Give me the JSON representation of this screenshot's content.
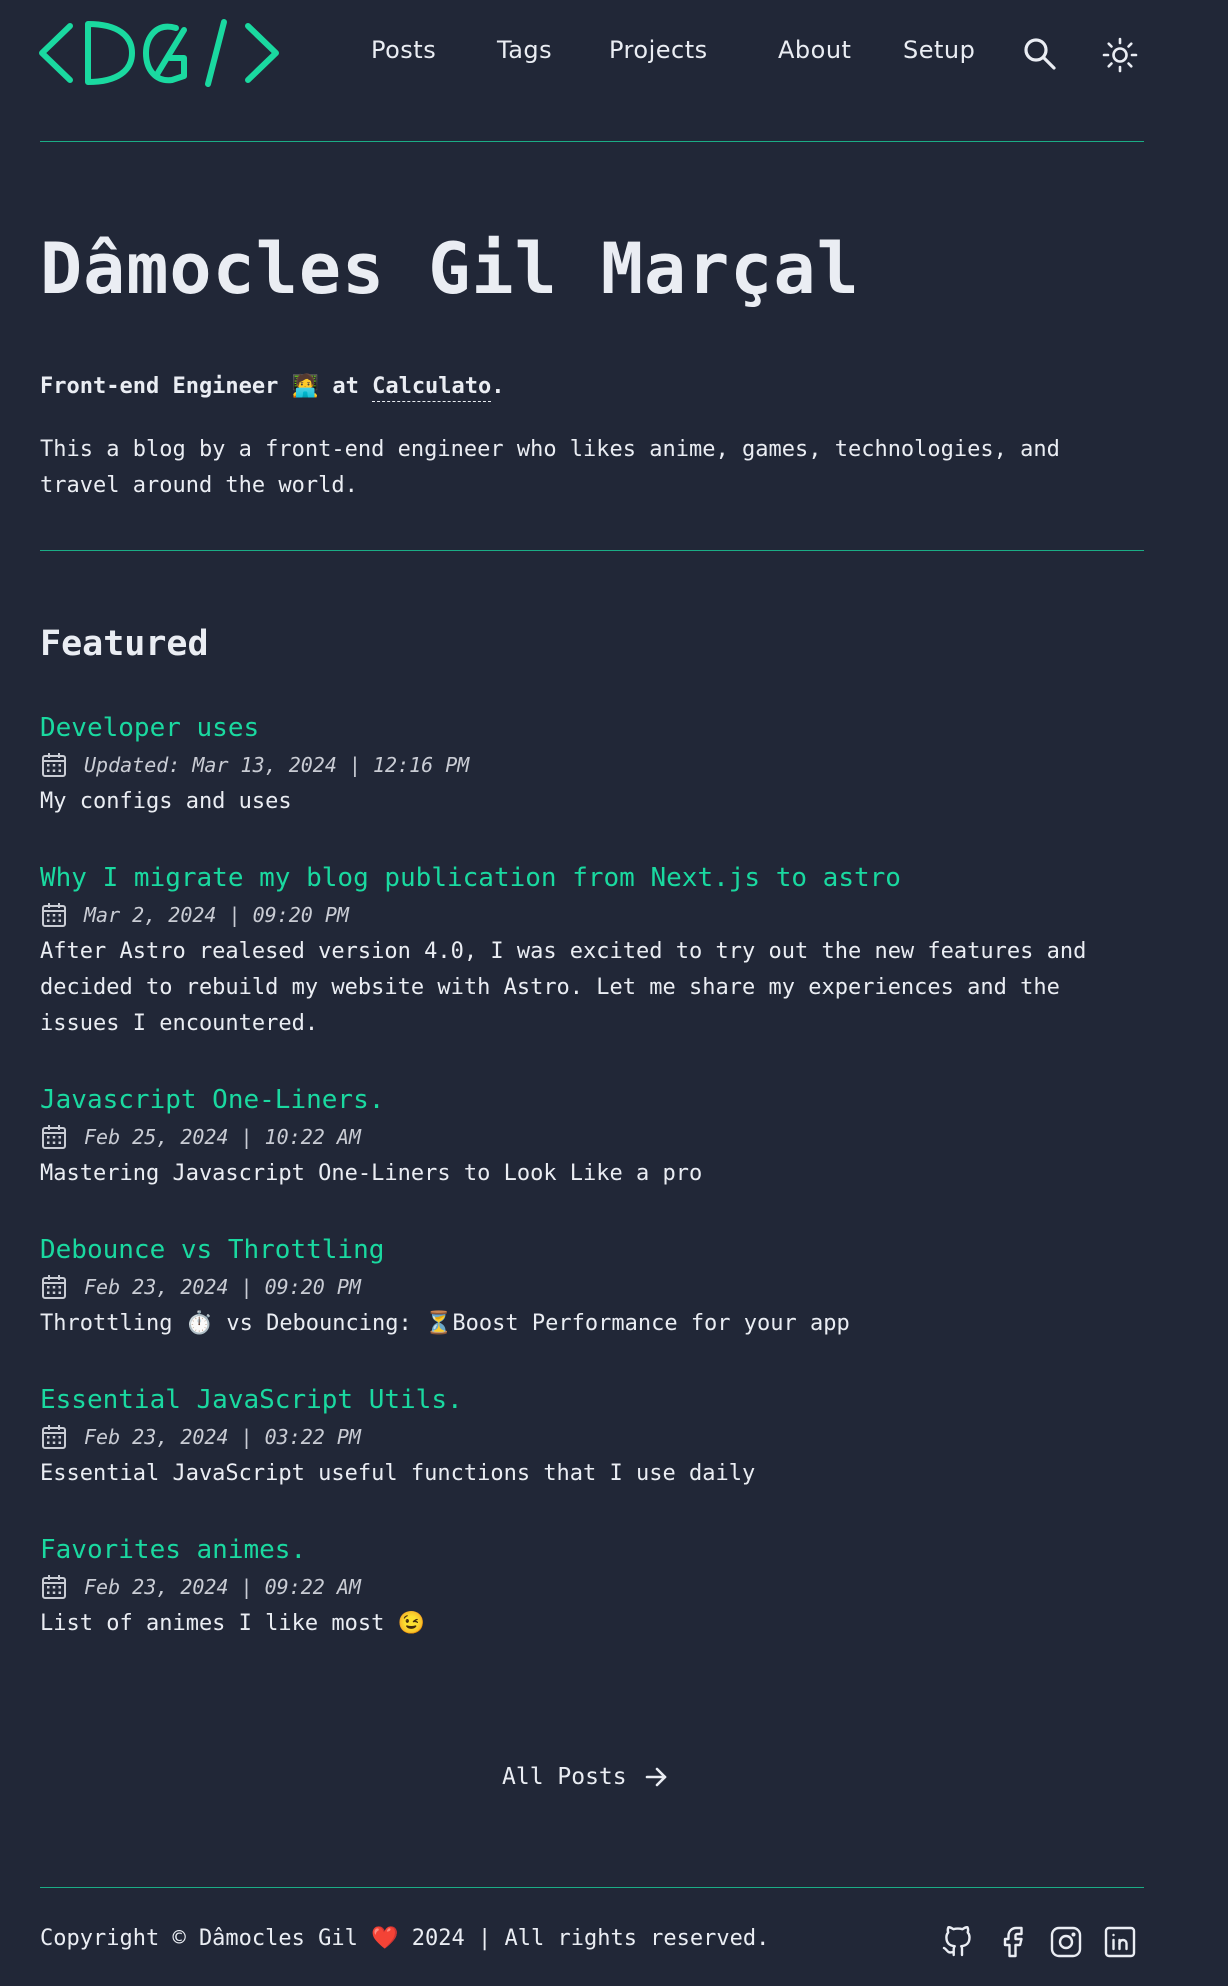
{
  "header": {
    "logo_text": "<DG/>",
    "nav": [
      "Posts",
      "Tags",
      "Projects",
      "About",
      "Setup"
    ],
    "search_icon": "search-icon",
    "theme_icon": "sun-icon"
  },
  "hero": {
    "title": "Dâmocles Gil Marçal",
    "role_prefix": "Front-end Engineer",
    "role_emoji": "🧑‍💻",
    "role_at": "at",
    "company": "Calculato",
    "company_suffix": ".",
    "intro": "This a blog by a front-end engineer who likes anime, games, technologies, and travel around the world."
  },
  "featured": {
    "heading": "Featured",
    "posts": [
      {
        "title": "Developer uses",
        "date": "Updated: Mar 13, 2024 | 12:16 PM",
        "description": "My configs and uses"
      },
      {
        "title": "Why I migrate my blog publication from Next.js to astro",
        "date": "Mar 2, 2024 | 09:20 PM",
        "description": "After Astro realesed version 4.0, I was excited to try out the new features and decided to rebuild my website with Astro. Let me share my experiences and the issues I encountered."
      },
      {
        "title": "Javascript One-Liners.",
        "date": "Feb 25, 2024 | 10:22 AM",
        "description": "Mastering Javascript One-Liners to Look Like a pro"
      },
      {
        "title": "Debounce vs Throttling",
        "date": "Feb 23, 2024 | 09:20 PM",
        "description": "Throttling ⏱️ vs Debouncing: ⏳Boost Performance for your app"
      },
      {
        "title": "Essential JavaScript Utils.",
        "date": "Feb 23, 2024 | 03:22 PM",
        "description": "Essential JavaScript useful functions that I use daily"
      },
      {
        "title": "Favorites animes.",
        "date": "Feb 23, 2024 | 09:22 AM",
        "description": "List of animes I like most 😉"
      }
    ]
  },
  "all_posts": {
    "label": "All Posts",
    "icon": "arrow-right-icon"
  },
  "footer": {
    "copyright": "Copyright © Dâmocles Gil ❤️ 2024 | All rights reserved.",
    "social": [
      "github-icon",
      "facebook-icon",
      "instagram-icon",
      "linkedin-icon"
    ]
  },
  "colors": {
    "background": "#212737",
    "accent": "#1ad9a0",
    "text": "#eaedf3"
  }
}
